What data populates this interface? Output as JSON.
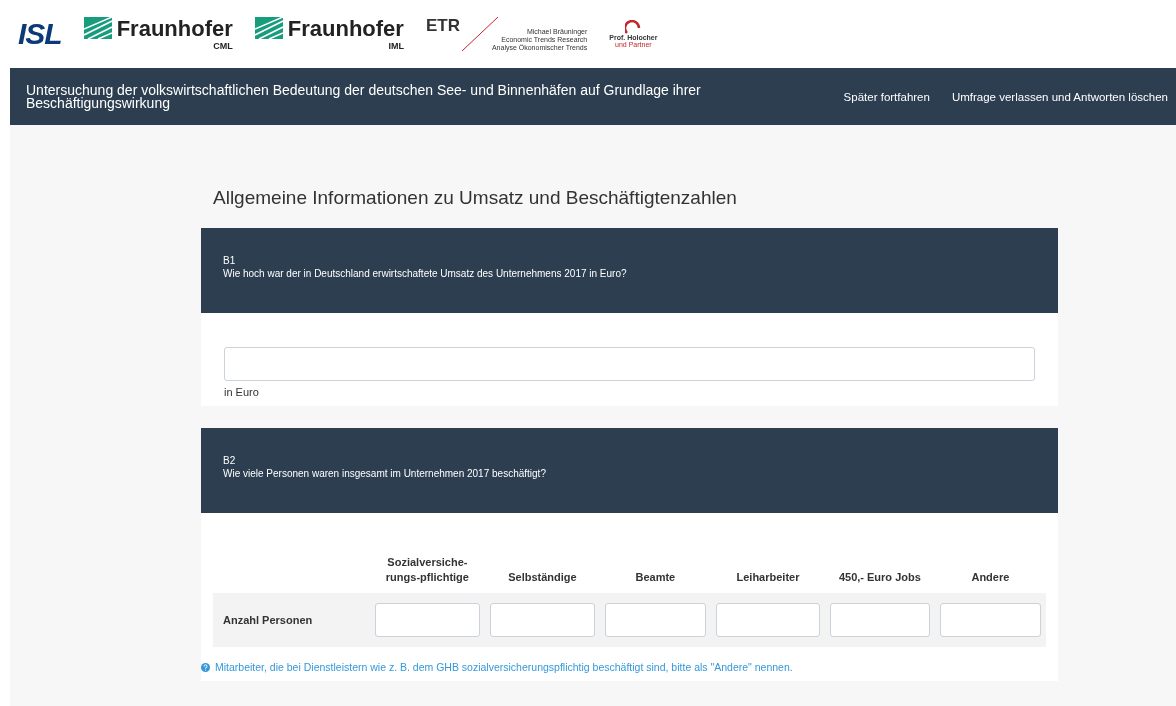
{
  "logos": [
    {
      "kind": "isl",
      "text": "ISL"
    },
    {
      "kind": "fraunhofer",
      "text": "Fraunhofer",
      "sub": "CML"
    },
    {
      "kind": "fraunhofer",
      "text": "Fraunhofer",
      "sub": "IML"
    },
    {
      "kind": "etr",
      "text": "ETR",
      "lines": [
        "Michael Bräuninger",
        "Economic Trends Research",
        "Analyse Ökonomischer Trends"
      ]
    },
    {
      "kind": "holocher",
      "text": "Prof. Holocher",
      "sub": "und Partner"
    }
  ],
  "header": {
    "title": "Untersuchung der volkswirtschaftlichen Bedeutung der deutschen See- und Binnenhäfen auf Grundlage ihrer Beschäftigungswirkung",
    "links": [
      "Später fortfahren",
      "Umfrage verlassen und Antworten löschen"
    ]
  },
  "section_title": "Allgemeine Informationen zu Umsatz und Beschäftigtenzahlen",
  "questions": [
    {
      "kind": "text",
      "code": "B1",
      "text": "Wie hoch war der in Deutschland erwirtschaftete Umsatz des Unternehmens 2017 in Euro?",
      "suffix": "in Euro"
    },
    {
      "kind": "matrix",
      "code": "B2",
      "text": "Wie viele Personen waren insgesamt im Unternehmen 2017 beschäftigt?",
      "columns": [
        "Sozialversiche-rungs-pflichtige",
        "Selbständige",
        "Beamte",
        "Leiharbeiter",
        "450,- Euro Jobs",
        "Andere"
      ],
      "row": "Anzahl Personen",
      "hint": "Mitarbeiter, die bei Dienstleistern wie z. B. dem GHB sozialversicherungspflichtig beschäftigt sind, bitte als \"Andere\" nennen."
    }
  ]
}
